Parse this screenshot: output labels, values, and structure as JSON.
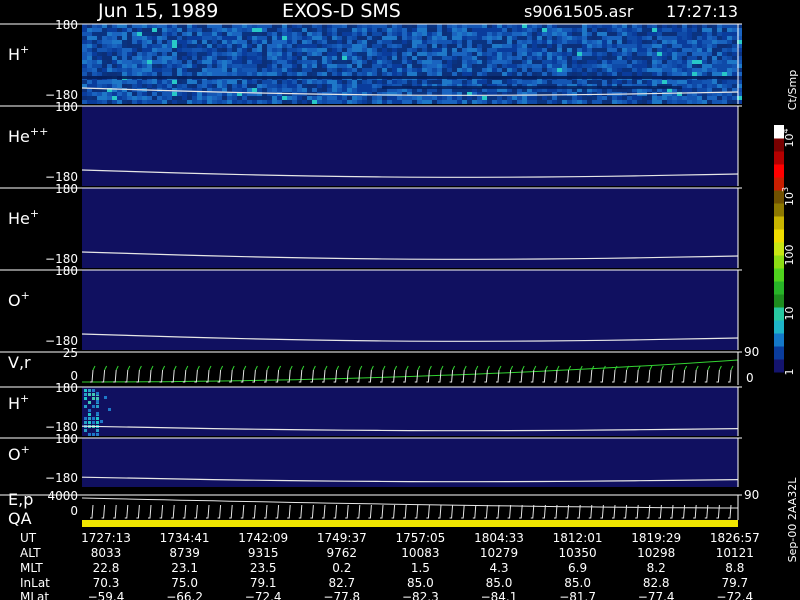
{
  "header": {
    "date": "Jun 15, 1989",
    "instrument": "EXOS-D SMS",
    "file": "s9061505.asr",
    "time": "17:27:13"
  },
  "colorbar": {
    "label": "Ct/Smp",
    "ticks": [
      {
        "text": "10",
        "sup": "4",
        "value": 10000
      },
      {
        "text": "10",
        "sup": "3",
        "value": 1000
      },
      {
        "text": "100",
        "sup": "",
        "value": 100
      },
      {
        "text": "10",
        "sup": "",
        "value": 10
      },
      {
        "text": "1",
        "sup": "",
        "value": 1
      }
    ],
    "colors": [
      "#14146e",
      "#0a3c9c",
      "#1478c8",
      "#1eb4c8",
      "#28c8a0",
      "#1e8c1e",
      "#28b428",
      "#50d21e",
      "#8cdc14",
      "#c8e614",
      "#f0dc00",
      "#c8b400",
      "#8c7800",
      "#6e5000",
      "#c81e00",
      "#ff0000",
      "#b40000",
      "#780000",
      "#ffffff"
    ]
  },
  "sidebar_label": "Sep-00 2AA32L",
  "chart_data": {
    "type": "heatmap",
    "x": [
      "1727:13",
      "1734:41",
      "1742:09",
      "1749:37",
      "1757:05",
      "1804:33",
      "1812:01",
      "1819:29",
      "1826:57"
    ],
    "panels": [
      {
        "name": "H",
        "sup": "+",
        "ytop": "180",
        "ybot": "−180",
        "ylim": [
          -180,
          180
        ],
        "activity": "high"
      },
      {
        "name": "He",
        "sup": "++",
        "ytop": "180",
        "ybot": "−180",
        "ylim": [
          -180,
          180
        ],
        "activity": "none"
      },
      {
        "name": "He",
        "sup": "+",
        "ytop": "180",
        "ybot": "−180",
        "ylim": [
          -180,
          180
        ],
        "activity": "none"
      },
      {
        "name": "O",
        "sup": "+",
        "ytop": "180",
        "ybot": "−180",
        "ylim": [
          -180,
          180
        ],
        "activity": "none"
      },
      {
        "name": "V,r",
        "sup": "",
        "ytop": "25",
        "ybot": "0",
        "rtop": "90",
        "rbot": "0",
        "kind": "line"
      },
      {
        "name": "H",
        "sup": "+",
        "ytop": "180",
        "ybot": "−180",
        "ylim": [
          -180,
          180
        ],
        "activity": "early"
      },
      {
        "name": "O",
        "sup": "+",
        "ytop": "180",
        "ybot": "−180",
        "ylim": [
          -180,
          180
        ],
        "activity": "none"
      },
      {
        "name": "E,p",
        "sup": "",
        "ytop": "4000",
        "ybot": "0",
        "rtop": "90",
        "kind": "line"
      },
      {
        "name": "QA",
        "sup": "",
        "kind": "qa"
      }
    ]
  },
  "ephemeris": [
    {
      "label": "UT",
      "values": [
        "1727:13",
        "1734:41",
        "1742:09",
        "1749:37",
        "1757:05",
        "1804:33",
        "1812:01",
        "1819:29",
        "1826:57"
      ]
    },
    {
      "label": "ALT",
      "values": [
        "8033",
        "8739",
        "9315",
        "9762",
        "10083",
        "10279",
        "10350",
        "10298",
        "10121"
      ]
    },
    {
      "label": "MLT",
      "values": [
        "22.8",
        "23.1",
        "23.5",
        "0.2",
        "1.5",
        "4.3",
        "6.9",
        "8.2",
        "8.8"
      ]
    },
    {
      "label": "InLat",
      "values": [
        "70.3",
        "75.0",
        "79.1",
        "82.7",
        "85.0",
        "85.0",
        "85.0",
        "82.8",
        "79.7"
      ]
    },
    {
      "label": "MLat",
      "values": [
        "−59.4",
        "−66.2",
        "−72.4",
        "−77.8",
        "−82.3",
        "−84.1",
        "−81.7",
        "−77.4",
        "−72.4"
      ]
    }
  ]
}
